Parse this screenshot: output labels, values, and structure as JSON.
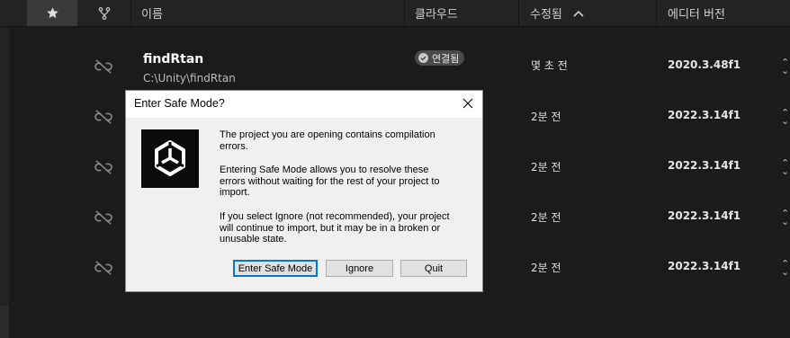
{
  "header": {
    "name_label": "이름",
    "cloud_label": "클라우드",
    "modified_label": "수정됨",
    "editor_version_label": "에디터 버전",
    "star_icon": "star-icon",
    "branch_icon": "branch-icon",
    "sort_icon": "chevron-up-icon"
  },
  "projects": [
    {
      "name": "findRtan",
      "path": "C:\\Unity\\findRtan",
      "cloud": "연결됨",
      "modified": "몇 초 전",
      "version": "2020.3.48f1"
    },
    {
      "modified": "2분 전",
      "version": "2022.3.14f1"
    },
    {
      "modified": "2분 전",
      "version": "2022.3.14f1"
    },
    {
      "modified": "2분 전",
      "version": "2022.3.14f1"
    },
    {
      "modified": "2분 전",
      "version": "2022.3.14f1"
    }
  ],
  "dialog": {
    "title": "Enter Safe Mode?",
    "paragraph1_line1": "The project you are opening contains compilation",
    "paragraph1_line2": "errors.",
    "paragraph2_line1": "Entering Safe Mode allows you to resolve these",
    "paragraph2_line2": "errors without waiting for the rest of your project to",
    "paragraph2_line3": "import.",
    "paragraph3_line1": "If you select Ignore (not recommended), your project",
    "paragraph3_line2": "will continue to import, but it may be in a broken or",
    "paragraph3_line3": "unusable state.",
    "btn_safe_mode": "Enter Safe Mode",
    "btn_ignore": "Ignore",
    "btn_quit": "Quit"
  }
}
